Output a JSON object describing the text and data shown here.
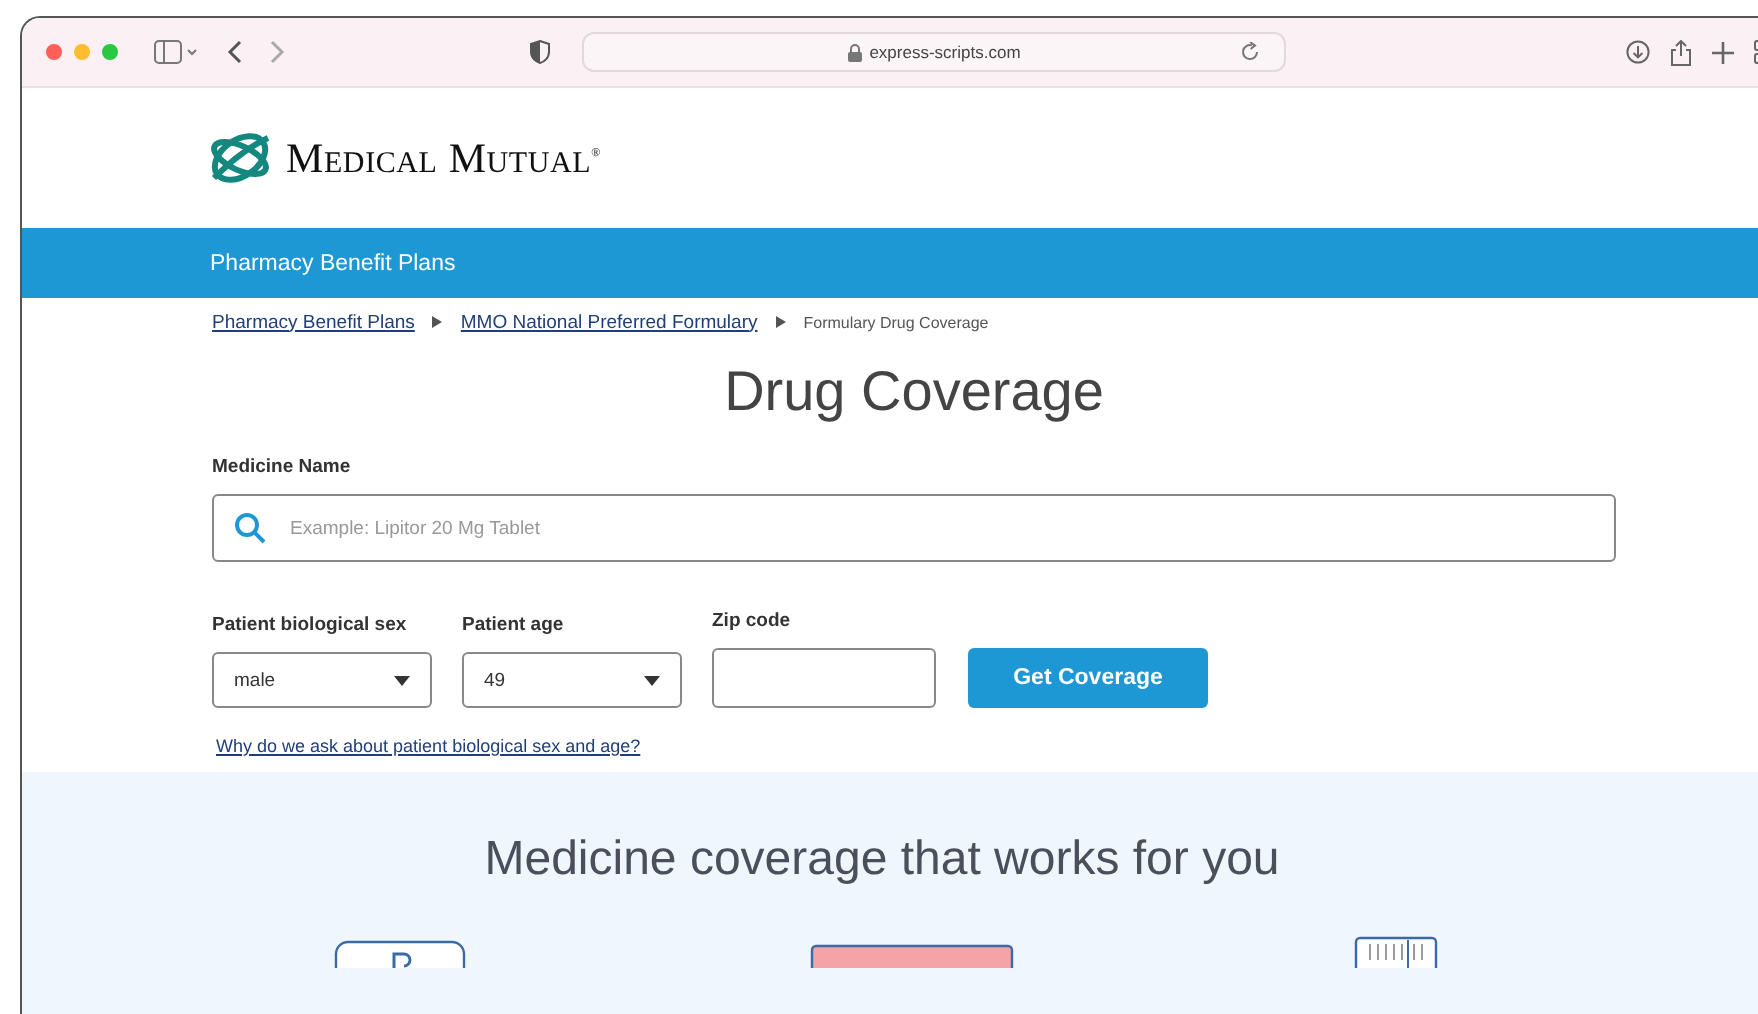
{
  "browser": {
    "url": "express-scripts.com"
  },
  "brand": {
    "name": "Medical Mutual",
    "mark": "®"
  },
  "nav_bar": {
    "title": "Pharmacy Benefit Plans"
  },
  "breadcrumbs": [
    {
      "label": "Pharmacy Benefit Plans",
      "kind": "link"
    },
    {
      "label": "MMO National Preferred Formulary",
      "kind": "link"
    },
    {
      "label": "Formulary Drug Coverage",
      "kind": "current"
    }
  ],
  "heading": "Drug Coverage",
  "medicine_field": {
    "label": "Medicine Name",
    "placeholder": "Example: Lipitor 20 Mg Tablet"
  },
  "filters": [
    {
      "label": "Patient biological sex",
      "kind": "select",
      "value": "male"
    },
    {
      "label": "Patient age",
      "kind": "select",
      "value": "49"
    },
    {
      "label": "Zip code",
      "kind": "text"
    }
  ],
  "submit_button": "Get Coverage",
  "help_link": "Why do we ask about patient biological sex and age?",
  "promo": {
    "heading": "Medicine coverage that works for you"
  }
}
